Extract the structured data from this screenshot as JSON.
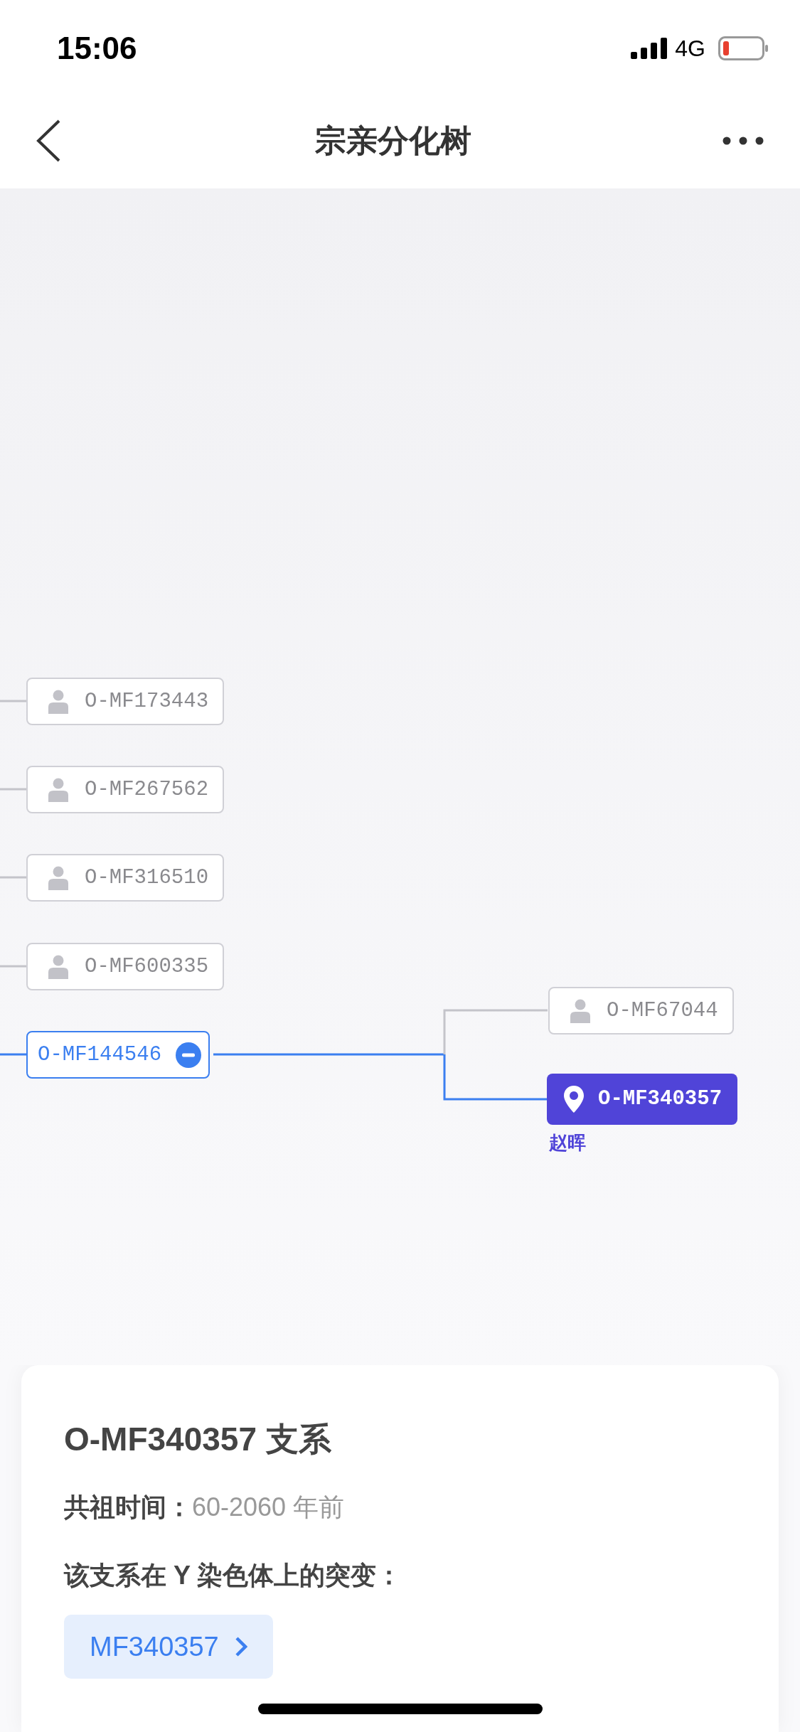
{
  "status_bar": {
    "time": "15:06",
    "network": "4G"
  },
  "nav": {
    "title": "宗亲分化树"
  },
  "tree": {
    "nodes": [
      {
        "label": "O-MF173443",
        "kind": "member"
      },
      {
        "label": "O-MF267562",
        "kind": "member"
      },
      {
        "label": "O-MF316510",
        "kind": "member"
      },
      {
        "label": "O-MF600335",
        "kind": "member"
      },
      {
        "label": "O-MF144546",
        "kind": "branch",
        "expanded": true,
        "children": [
          {
            "label": "O-MF67044",
            "kind": "member"
          },
          {
            "label": "O-MF340357",
            "kind": "current",
            "name": "赵晖"
          }
        ]
      }
    ]
  },
  "card": {
    "title": "O-MF340357 支系",
    "time_label": "共祖时间：",
    "time_value": "60-2060 年前",
    "mutations_label": "该支系在 Y 染色体上的突变：",
    "mutations": [
      "MF340357"
    ]
  }
}
